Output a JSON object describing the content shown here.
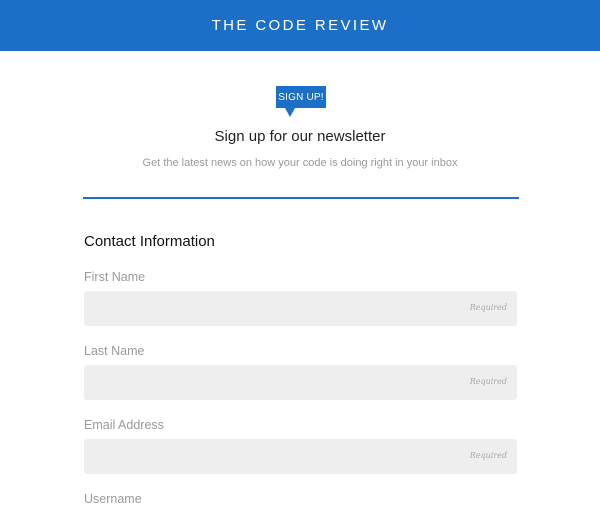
{
  "header": {
    "title": "THE CODE REVIEW"
  },
  "badge": {
    "label": "SIGN UP!"
  },
  "hero": {
    "title": "Sign up for our newsletter",
    "subtitle": "Get the latest news on how your code is doing right in your inbox"
  },
  "form": {
    "section_title": "Contact Information",
    "required_label": "Required",
    "fields": [
      {
        "label": "First Name",
        "value": "",
        "placeholder": ""
      },
      {
        "label": "Last Name",
        "value": "",
        "placeholder": ""
      },
      {
        "label": "Email Address",
        "value": "",
        "placeholder": ""
      },
      {
        "label": "Username",
        "value": "",
        "placeholder": ""
      }
    ]
  },
  "colors": {
    "brand": "#1b6fc6",
    "input_bg": "#eeeeee",
    "muted_text": "#9a9a9a"
  }
}
